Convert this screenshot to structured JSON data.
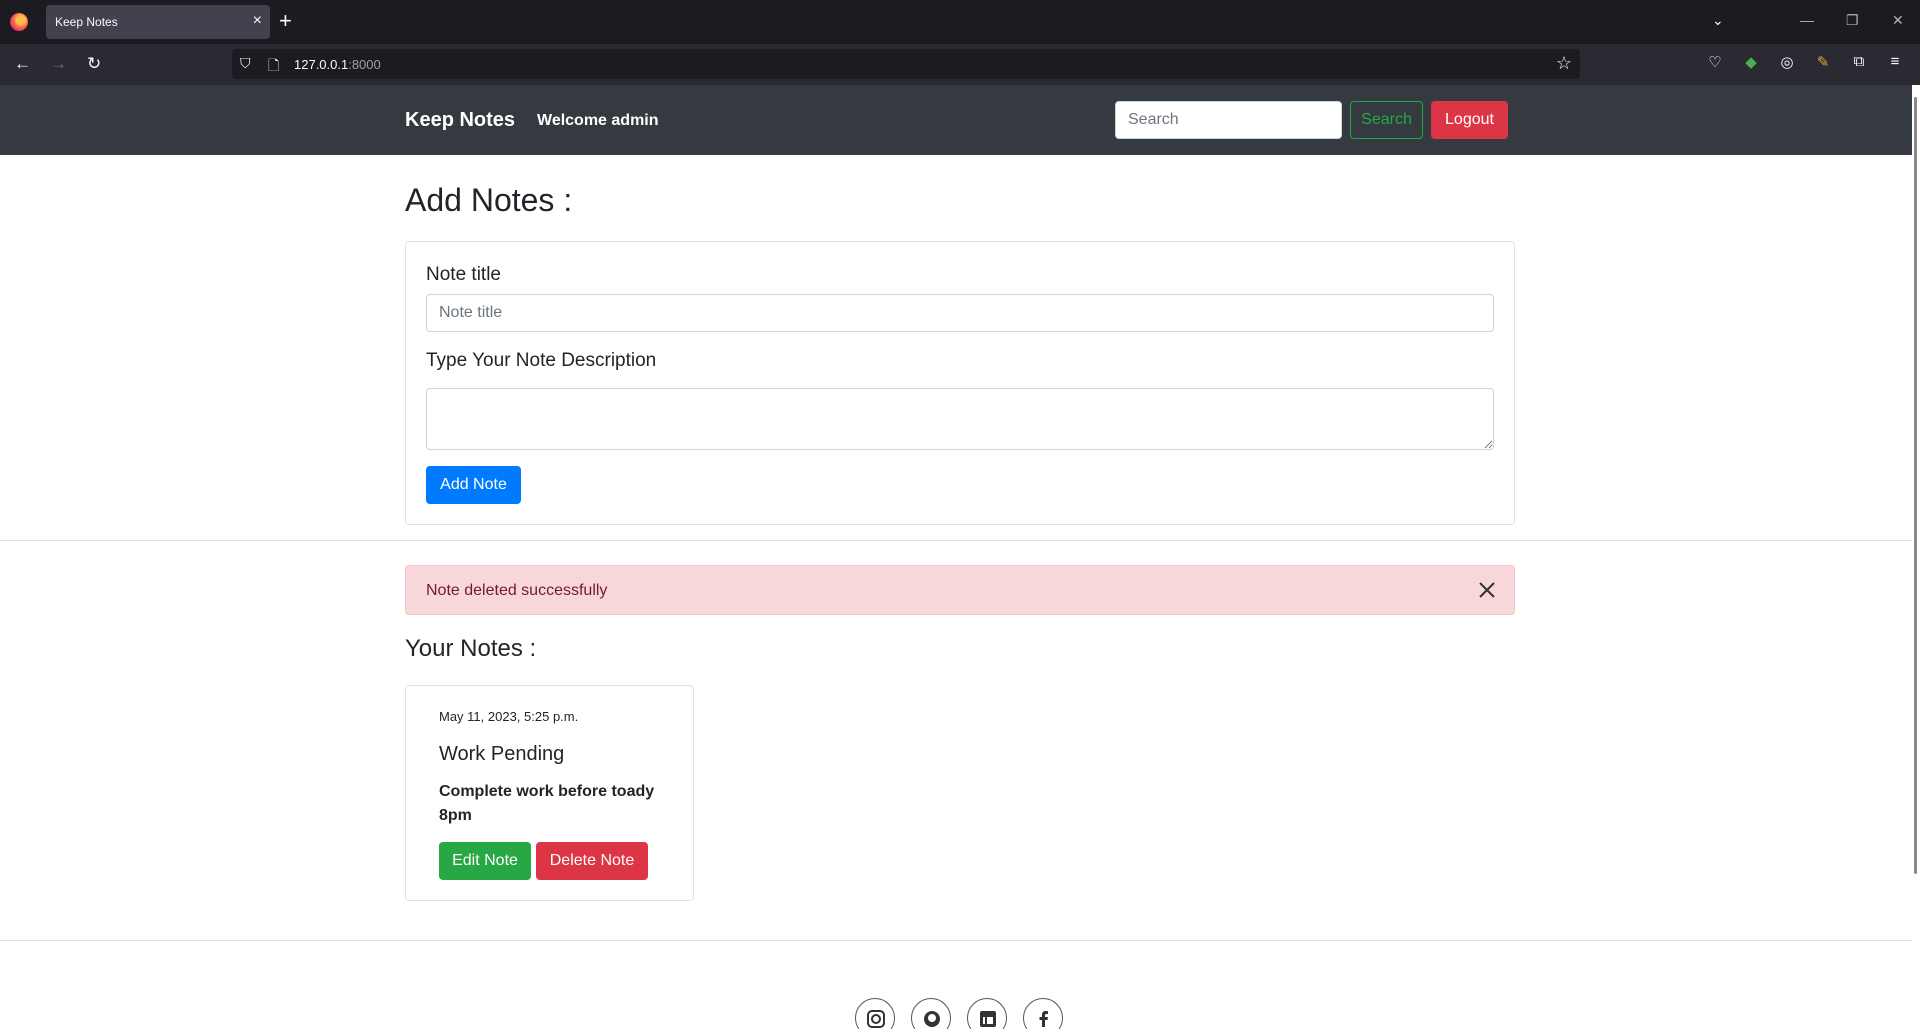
{
  "browser": {
    "tab_title": "Keep Notes",
    "url_host": "127.0.0.1",
    "url_port": ":8000"
  },
  "nav": {
    "brand": "Keep Notes",
    "welcome": "Welcome admin",
    "search_placeholder": "Search",
    "search_button": "Search",
    "logout_button": "Logout"
  },
  "add_form": {
    "heading": "Add Notes :",
    "title_label": "Note title",
    "title_placeholder": "Note title",
    "description_label": "Type Your Note Description",
    "add_button": "Add Note"
  },
  "alert": {
    "message": "Note deleted successfully"
  },
  "notes_section": {
    "heading": "Your Notes :",
    "notes": [
      {
        "date": "May 11, 2023, 5:25 p.m.",
        "title": "Work Pending",
        "description": "Complete work before toady 8pm",
        "edit_label": "Edit Note",
        "delete_label": "Delete Note"
      }
    ]
  },
  "footer": {
    "social_icons": [
      "instagram-icon",
      "github-icon",
      "linkedin-icon",
      "facebook-icon"
    ]
  },
  "colors": {
    "navbar": "#343a40",
    "primary": "#007bff",
    "success": "#28a745",
    "danger": "#dc3545",
    "alert_bg": "#f8d7da",
    "alert_text": "#721c24"
  }
}
